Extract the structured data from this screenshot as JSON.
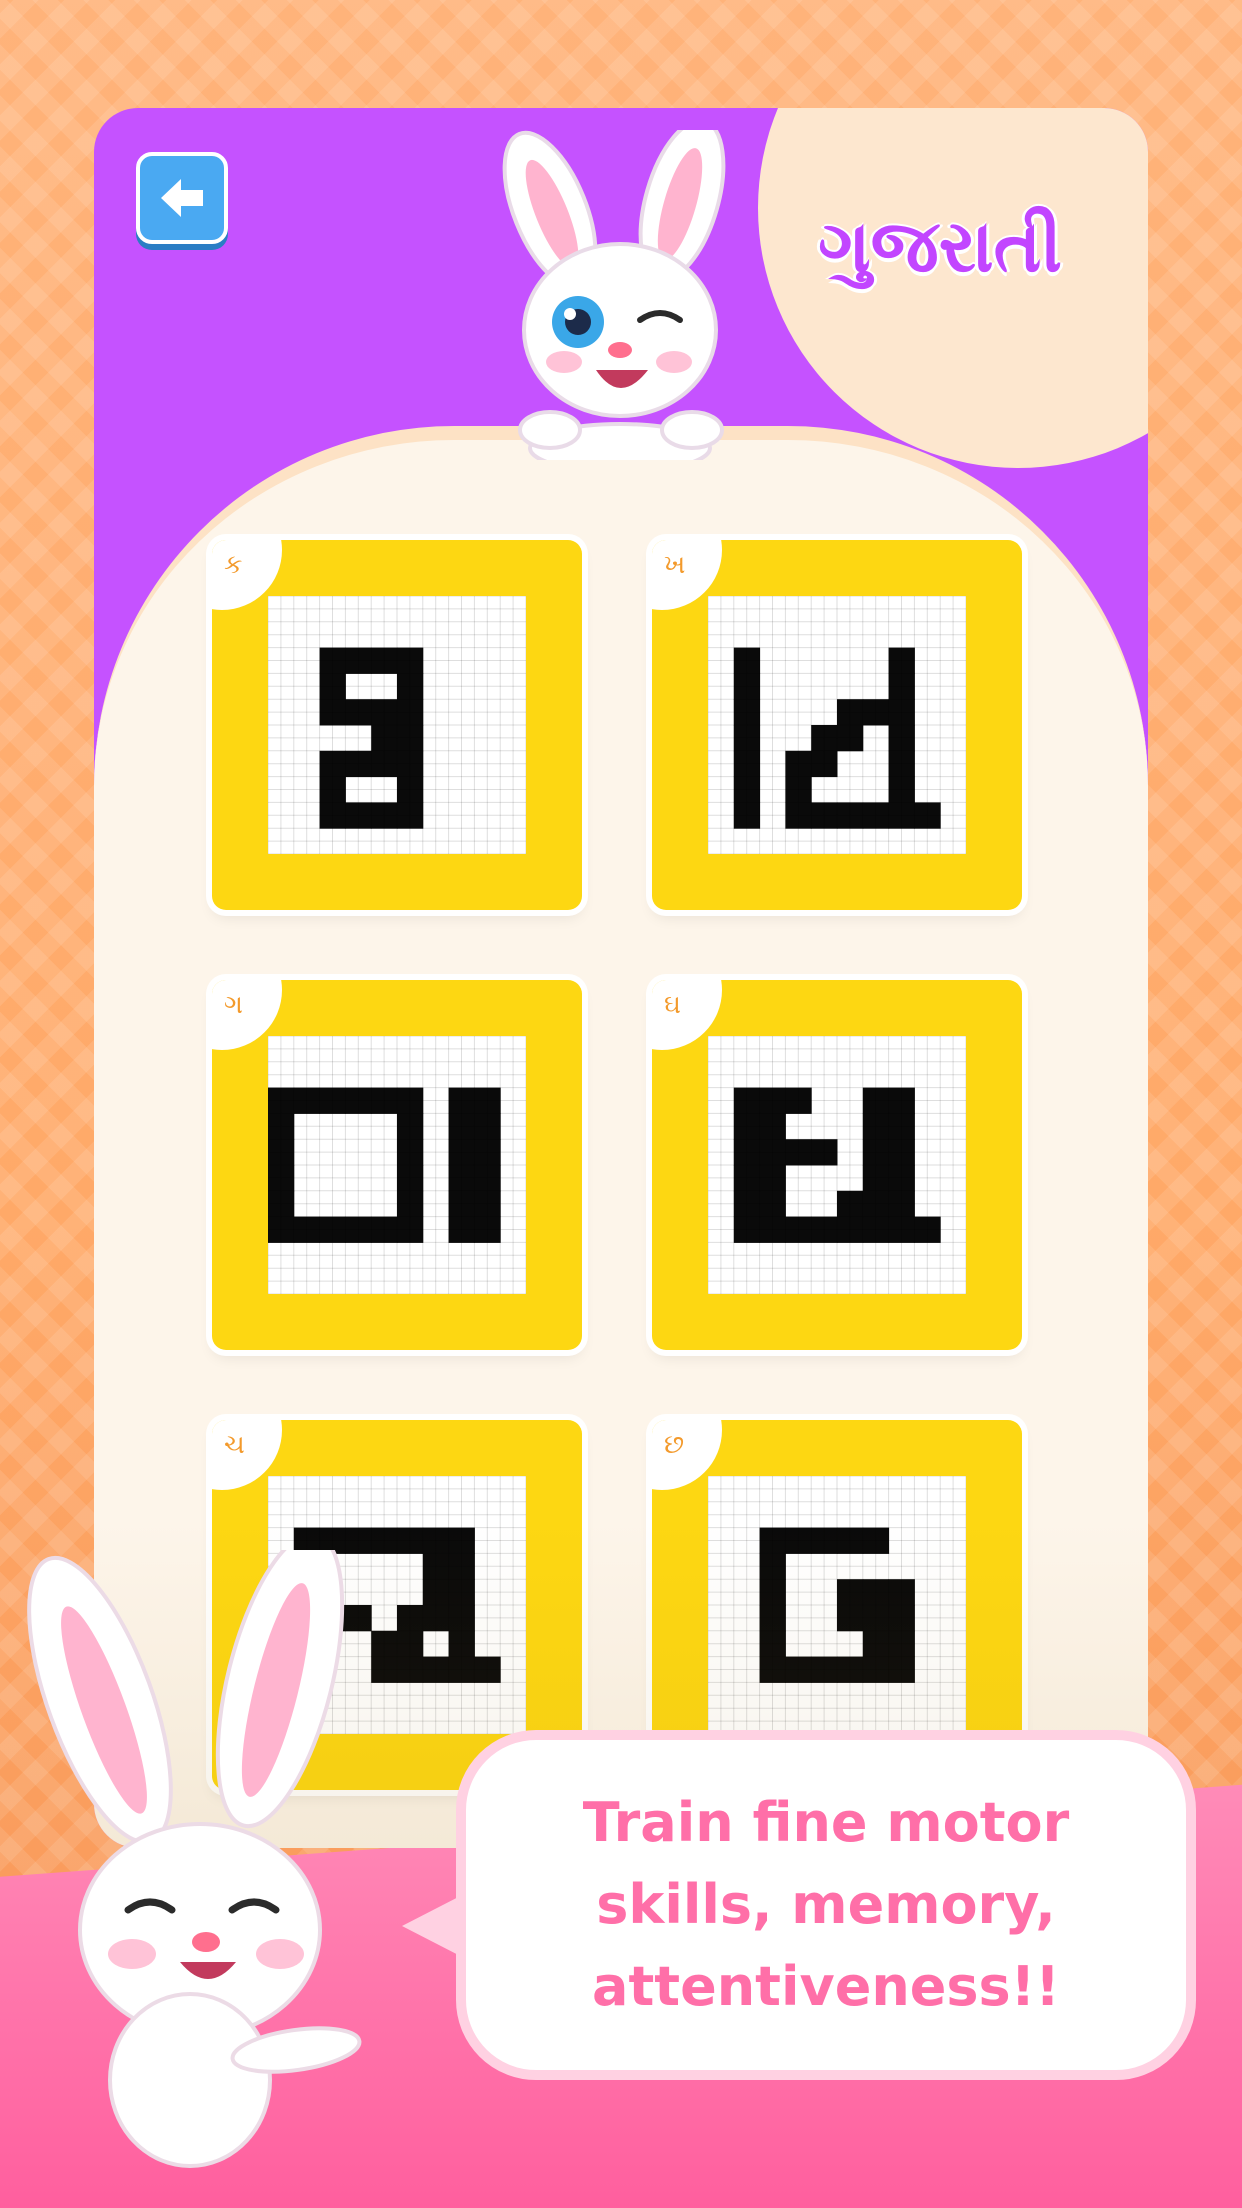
{
  "header": {
    "language_label": "ગુજરાતી",
    "back_icon": "arrow-left-icon"
  },
  "letters": [
    {
      "label": "ક",
      "grid": [
        "0000000000",
        "0000000000",
        "0011110000",
        "0010010000",
        "0011110000",
        "0000110000",
        "0011110000",
        "0010010000",
        "0011110000",
        "0000000000"
      ]
    },
    {
      "label": "ખ",
      "grid": [
        "0000000000",
        "0000000000",
        "0100000100",
        "0100000100",
        "0100011100",
        "0100110100",
        "0101100100",
        "0101000100",
        "0101111110",
        "0000000000"
      ]
    },
    {
      "label": "ગ",
      "grid": [
        "0000000000",
        "0000000000",
        "1111110110",
        "1000010110",
        "1000010110",
        "1000010110",
        "1000010110",
        "1111110110",
        "0000000000",
        "0000000000"
      ]
    },
    {
      "label": "ઘ",
      "grid": [
        "0000000000",
        "0000000000",
        "0111001100",
        "0110001100",
        "0111101100",
        "0110001100",
        "0110011100",
        "0111111110",
        "0000000000",
        "0000000000"
      ]
    },
    {
      "label": "ચ",
      "grid": [
        "0000000000",
        "0000000000",
        "0111111100",
        "0100001100",
        "0100001100",
        "0111011100",
        "0000110100",
        "0000111110",
        "0000000000",
        "0000000000"
      ]
    },
    {
      "label": "છ",
      "grid": [
        "0000000000",
        "0000000000",
        "0011111000",
        "0010000000",
        "0010011100",
        "0010011100",
        "0010001100",
        "0011111100",
        "0000000000",
        "0000000000"
      ]
    }
  ],
  "bubble": {
    "lines": [
      "Train fine motor",
      "skills, memory,",
      "attentiveness!!"
    ]
  },
  "colors": {
    "panel": "#c552ff",
    "card": "#fdd712",
    "accent_pink": "#ff6fa8",
    "language_text": "#c245ff"
  }
}
